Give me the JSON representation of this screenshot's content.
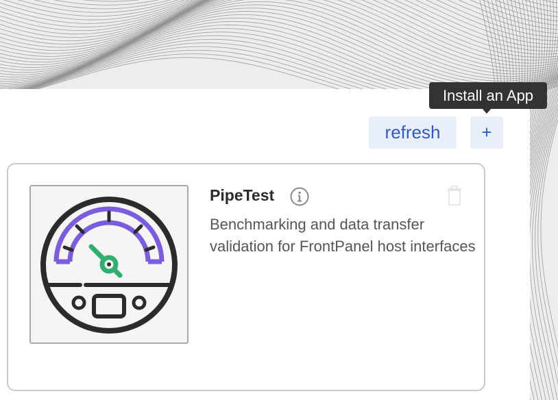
{
  "toolbar": {
    "refresh_label": "refresh",
    "install_label": "+",
    "install_tooltip": "Install an App"
  },
  "apps": [
    {
      "name": "PipeTest",
      "description": "Benchmarking and data transfer validation for FrontPanel host interfaces",
      "icon": "gauge-icon"
    }
  ],
  "colors": {
    "button_bg": "#e8effb",
    "button_text": "#2f5bc9",
    "tooltip_bg": "#333333",
    "gauge_arc": "#7b5ce0",
    "gauge_needle": "#2fb06e"
  }
}
